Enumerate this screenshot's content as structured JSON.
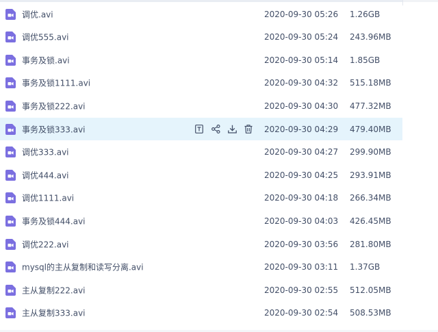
{
  "files": [
    {
      "name": "调优.avi",
      "time": "2020-09-30 05:26",
      "size": "1.26GB"
    },
    {
      "name": "调优555.avi",
      "time": "2020-09-30 05:24",
      "size": "243.96MB"
    },
    {
      "name": "事务及锁.avi",
      "time": "2020-09-30 05:14",
      "size": "1.85GB"
    },
    {
      "name": "事务及锁1111.avi",
      "time": "2020-09-30 04:32",
      "size": "515.18MB"
    },
    {
      "name": "事务及锁222.avi",
      "time": "2020-09-30 04:30",
      "size": "477.32MB"
    },
    {
      "name": "事务及锁333.avi",
      "time": "2020-09-30 04:29",
      "size": "479.40MB"
    },
    {
      "name": "调优333.avi",
      "time": "2020-09-30 04:27",
      "size": "299.90MB"
    },
    {
      "name": "调优444.avi",
      "time": "2020-09-30 04:25",
      "size": "293.91MB"
    },
    {
      "name": "调优1111.avi",
      "time": "2020-09-30 04:18",
      "size": "266.34MB"
    },
    {
      "name": "事务及锁444.avi",
      "time": "2020-09-30 04:03",
      "size": "426.45MB"
    },
    {
      "name": "调优222.avi",
      "time": "2020-09-30 03:56",
      "size": "281.80MB"
    },
    {
      "name": "mysql的主从复制和读写分离.avi",
      "time": "2020-09-30 03:11",
      "size": "1.37GB"
    },
    {
      "name": "主从复制222.avi",
      "time": "2020-09-30 02:55",
      "size": "512.05MB"
    },
    {
      "name": "主从复制333.avi",
      "time": "2020-09-30 02:54",
      "size": "508.53MB"
    }
  ],
  "hovered_row": 5,
  "row_actions": [
    "rename-icon",
    "share-icon",
    "download-icon",
    "delete-icon"
  ],
  "colors": {
    "icon": "#7b6fe0",
    "hover_bg": "#e5f4fc",
    "text": "#424e67",
    "muted": "#5b6477"
  }
}
